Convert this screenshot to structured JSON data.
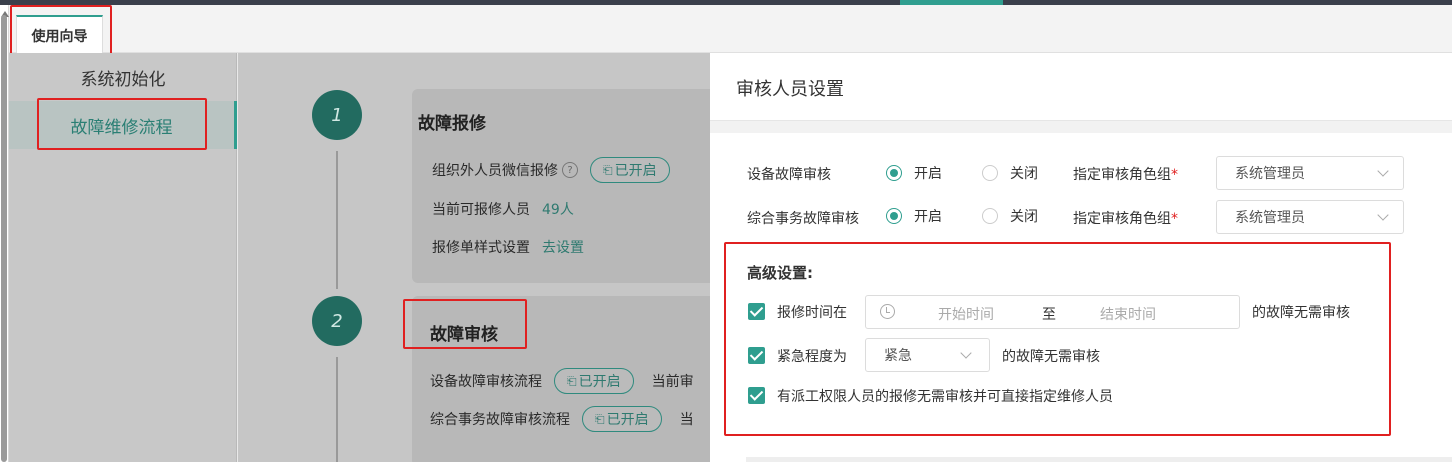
{
  "tab": {
    "label": "使用向导"
  },
  "nav": {
    "items": [
      {
        "label": "系统初始化"
      },
      {
        "label": "故障维修流程"
      }
    ]
  },
  "steps": [
    {
      "number": "1",
      "title": "故障报修",
      "rows": {
        "wechat_label": "组织外人员微信报修",
        "wechat_tag": "已开启",
        "people_label": "当前可报修人员",
        "people_value": "49人",
        "style_label": "报修单样式设置",
        "style_link": "去设置"
      }
    },
    {
      "number": "2",
      "title": "故障审核",
      "rows": {
        "device_label": "设备故障审核流程",
        "device_tag": "已开启",
        "device_trail": "当前审",
        "general_label": "综合事务故障审核流程",
        "general_tag": "已开启",
        "general_trail": "当"
      }
    }
  ],
  "drawer": {
    "title": "审核人员设置",
    "rows": [
      {
        "label": "设备故障审核",
        "on": "开启",
        "off": "关闭",
        "role_label": "指定审核角色组",
        "required": "*",
        "role_value": "系统管理员"
      },
      {
        "label": "综合事务故障审核",
        "on": "开启",
        "off": "关闭",
        "role_label": "指定审核角色组",
        "required": "*",
        "role_value": "系统管理员"
      }
    ],
    "advanced": {
      "title": "高级设置:",
      "time": {
        "label": "报修时间在",
        "start_placeholder": "开始时间",
        "sep": "至",
        "end_placeholder": "结束时间",
        "suffix": "的故障无需审核"
      },
      "urgency": {
        "label": "紧急程度为",
        "value": "紧急",
        "suffix": "的故障无需审核"
      },
      "dispatch": {
        "label": "有派工权限人员的报修无需审核并可直接指定维修人员"
      }
    }
  },
  "colors": {
    "accent": "#2f9e8f",
    "highlight": "#e02020"
  }
}
